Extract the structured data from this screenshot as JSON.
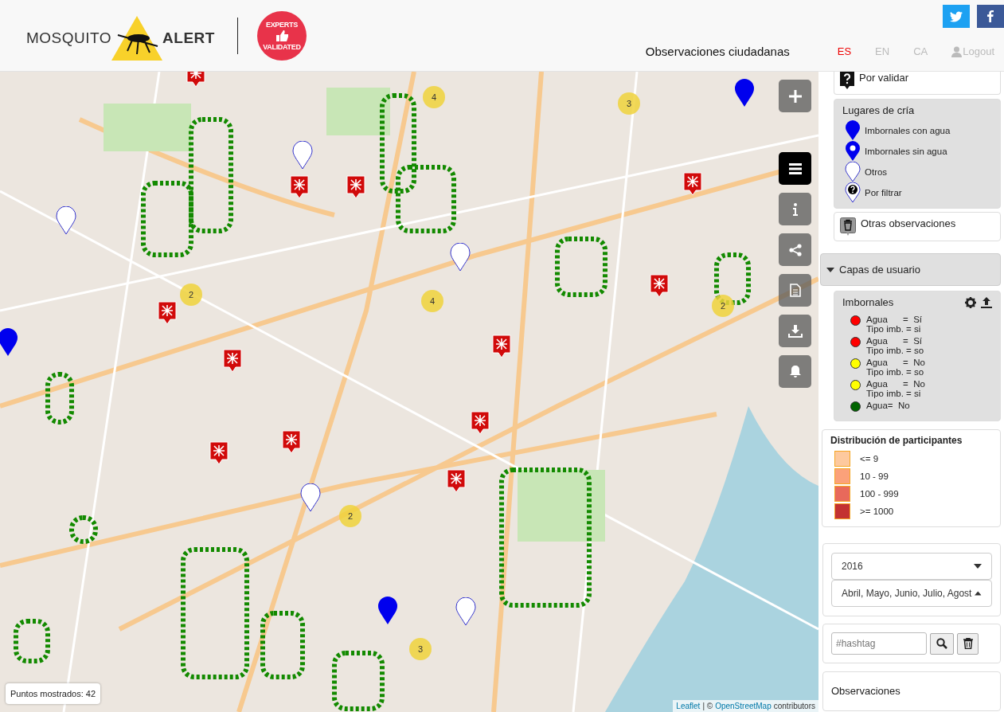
{
  "header": {
    "logo": {
      "left": "MOSQUITO",
      "right": "ALERT"
    },
    "badge": {
      "top": "EXPERTS",
      "bottom": "VALIDATED"
    },
    "nav_title": "Observaciones ciudadanas",
    "languages": [
      {
        "label": "ES",
        "selected": true
      },
      {
        "label": "EN",
        "selected": false
      },
      {
        "label": "CA",
        "selected": false
      }
    ],
    "logout": "Logout"
  },
  "map": {
    "clusters": [
      {
        "count": "4"
      },
      {
        "count": "3"
      },
      {
        "count": "2"
      },
      {
        "count": "4"
      },
      {
        "count": "2"
      },
      {
        "count": "2"
      },
      {
        "count": "3"
      }
    ],
    "controls": [
      {
        "kind": "zoom-in",
        "selected": false
      },
      {
        "kind": "menu",
        "selected": true
      },
      {
        "kind": "info",
        "selected": false
      },
      {
        "kind": "share",
        "selected": false
      },
      {
        "kind": "document",
        "selected": false
      },
      {
        "kind": "download",
        "selected": false
      },
      {
        "kind": "bell",
        "selected": false
      }
    ],
    "points_shown": "Puntos mostrados: 42",
    "attribution": {
      "library": "Leaflet",
      "separator": "| ©",
      "source": "OpenStreetMap",
      "suffix": "contributors"
    }
  },
  "sidebar": {
    "por_validar": "Por validar",
    "lugares": {
      "title": "Lugares de cría",
      "items": [
        {
          "kind": "filled",
          "label": "Imbornales con agua"
        },
        {
          "kind": "ring",
          "label": "Imbornales sin agua"
        },
        {
          "kind": "empty",
          "label": "Otros"
        },
        {
          "kind": "question",
          "label": "Por filtrar"
        }
      ]
    },
    "otras": "Otras observaciones",
    "capas": {
      "title": "Capas de usuario",
      "expanded": true
    },
    "imbornales": {
      "title": "Imbornales",
      "items": [
        {
          "color": "#ff0000",
          "lines": [
            "Agua      =  Sí",
            "Tipo imb. = si"
          ]
        },
        {
          "color": "#ff0000",
          "lines": [
            "Agua      =  Sí",
            "Tipo imb. = so"
          ]
        },
        {
          "color": "#ffff00",
          "lines": [
            "Agua      =  No",
            "Tipo imb. = so"
          ]
        },
        {
          "color": "#ffff00",
          "lines": [
            "Agua      =  No",
            "Tipo imb. = si"
          ]
        },
        {
          "color": "#006400",
          "lines": [
            "Agua=  No"
          ]
        }
      ]
    },
    "distribucion": {
      "title": "Distribución de participantes",
      "items": [
        {
          "color": "#fdc99e",
          "label": "<= 9"
        },
        {
          "color": "#fba17a",
          "label": "10 - 99"
        },
        {
          "color": "#e8695b",
          "label": "100 - 999"
        },
        {
          "color": "#c33232",
          "label": ">= 1000"
        }
      ]
    },
    "year": {
      "value": "2016",
      "open": false
    },
    "months": {
      "value": "Abril, Mayo, Junio, Julio, Agost",
      "open": true
    },
    "hashtag": {
      "placeholder": "#hashtag"
    },
    "observaciones": "Observaciones"
  }
}
